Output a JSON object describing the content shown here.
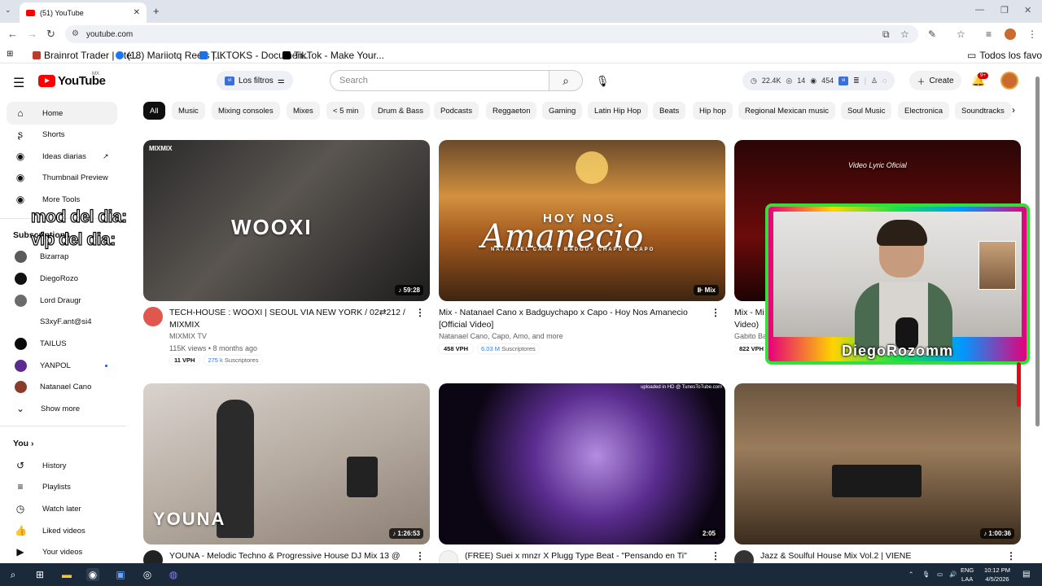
{
  "browser": {
    "tab_title": "(51) YouTube",
    "url": "youtube.com",
    "bookmarks": [
      "Brainrot Trader | Ste...",
      "(18) Mariiotq Reels |...",
      "TIKTOKS - Documen...",
      "TikTok - Make Your..."
    ],
    "all_bookmarks": "Todos los favoritos"
  },
  "header": {
    "logo": "YouTube",
    "region": "MX",
    "filters_label": "Los filtros",
    "search_placeholder": "Search",
    "stats": {
      "views": "22.4K",
      "likes": "14",
      "subs": "454"
    },
    "create_label": "Create",
    "notif_count": "9+"
  },
  "sidebar": {
    "main": [
      {
        "label": "Home"
      },
      {
        "label": "Shorts"
      },
      {
        "label": "Ideas diarias"
      },
      {
        "label": "Thumbnail Preview"
      },
      {
        "label": "More Tools"
      }
    ],
    "subscriptions_heading": "Subscriptions",
    "subscriptions": [
      {
        "label": "Bizarrap",
        "color": "#5a5a5a"
      },
      {
        "label": "DiegoRozo",
        "color": "#111111"
      },
      {
        "label": "Lord Draugr",
        "color": "#6b6b6b"
      },
      {
        "label": "S3xyF.ant@si4",
        "color": "#ffffff"
      },
      {
        "label": "TAILUS",
        "color": "#0a0a0a"
      },
      {
        "label": "YANPOL",
        "color": "#5b2b8f"
      },
      {
        "label": "Natanael Cano",
        "color": "#8a3b2a"
      }
    ],
    "show_more": "Show more",
    "you_heading": "You",
    "you_items": [
      {
        "label": "History"
      },
      {
        "label": "Playlists"
      },
      {
        "label": "Watch later"
      },
      {
        "label": "Liked videos"
      },
      {
        "label": "Your videos"
      }
    ]
  },
  "chips": [
    "All",
    "Music",
    "Mixing consoles",
    "Mixes",
    "< 5 min",
    "Drum & Bass",
    "Podcasts",
    "Reggaeton",
    "Gaming",
    "Latin Hip Hop",
    "Beats",
    "Hip hop",
    "Regional Mexican music",
    "Soul Music",
    "Electronica",
    "Soundtracks"
  ],
  "videos": [
    {
      "title": "TECH-HOUSE : WOOXI | SEOUL VIA NEW YORK / 02⇄212 / MIXMIX",
      "channel": "MIXMIX TV",
      "meta": "115K views • 8 months ago",
      "vph": "11 VPH",
      "subs_num": "275 k",
      "subs_label": "Suscriptores",
      "duration": "59:28",
      "overlay": "WOOXI",
      "brand": "MIXMIX"
    },
    {
      "title": "Mix - Natanael Cano x Badguychapo x Capo - Hoy Nos Amanecio [Official Video]",
      "channel": "Natanael Cano, Capo, Amo, and more",
      "vph": "458 VPH",
      "subs_num": "6.03 M",
      "subs_label": "Suscriptores",
      "duration": "Mix",
      "overlay": "HOY NOS",
      "overlay2": "Amanecio",
      "overlay3": "NATANAEL CANO  x  BADGUY CHAPO  x  CAPO"
    },
    {
      "title": "Mix - Mi",
      "title2": "Video)",
      "channel": "Gabito Ba",
      "vph": "822 VPH",
      "overlay": "Video Lyric Oficial"
    },
    {
      "title": "YOUNA - Melodic Techno & Progressive House DJ Mix 13 @",
      "duration": "1:26:53",
      "overlay": "YOUNA"
    },
    {
      "title": "(FREE) Suei x mnzr X Plugg Type Beat - \"Pensando en Ti\"",
      "duration": "2:05",
      "uploaded": "uploaded in HD @ TunesToTube.com"
    },
    {
      "title": "Jazz & Soulful House Mix Vol.2 | VIENE",
      "duration": "1:00:36"
    }
  ],
  "overlay": {
    "stream_name": "DiegoRozomm",
    "mod_line": "mod del dia:",
    "vip_line": "vip del dia:"
  },
  "taskbar": {
    "lang": "ENG",
    "region": "LAA",
    "time": "10:12 PM",
    "date": "4/5/2026"
  }
}
